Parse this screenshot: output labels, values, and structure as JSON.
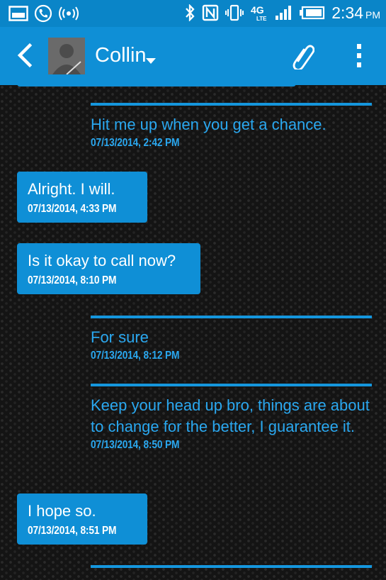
{
  "status_bar": {
    "time": "2:34",
    "ampm": "PM",
    "network_type": "4G LTE"
  },
  "header": {
    "contact_name": "Collin"
  },
  "messages": [
    {
      "direction": "incoming",
      "text": "Hit me up when you get a chance.",
      "time": "07/13/2014, 2:42 PM"
    },
    {
      "direction": "outgoing",
      "text": "Alright. I will.",
      "time": "07/13/2014, 4:33 PM"
    },
    {
      "direction": "outgoing",
      "text": "Is it okay to call now?",
      "time": "07/13/2014, 8:10 PM"
    },
    {
      "direction": "incoming",
      "text": "For sure",
      "time": "07/13/2014, 8:12 PM"
    },
    {
      "direction": "incoming",
      "text": "Keep your head up bro, things are about to change for the better, I guarantee it.",
      "time": "07/13/2014, 8:50 PM"
    },
    {
      "direction": "outgoing",
      "text": "I hope so.",
      "time": "07/13/2014, 8:51 PM"
    }
  ],
  "icons": {
    "status_left": [
      "gallery-icon",
      "phone-call-icon",
      "broadcast-icon"
    ],
    "status_right": [
      "bluetooth-icon",
      "nfc-icon",
      "vibrate-icon",
      "lte-signal-icon",
      "signal-bars-icon",
      "battery-icon"
    ],
    "header": [
      "back-arrow-icon",
      "avatar",
      "chevron-down-icon",
      "paperclip-icon",
      "overflow-menu-icon"
    ]
  },
  "colors": {
    "status_bar": "#0a85c8",
    "action_bar": "#0f8fd6",
    "bubble": "#0f8fd6",
    "incoming_text": "#2aa8f0",
    "background": "#141414"
  }
}
